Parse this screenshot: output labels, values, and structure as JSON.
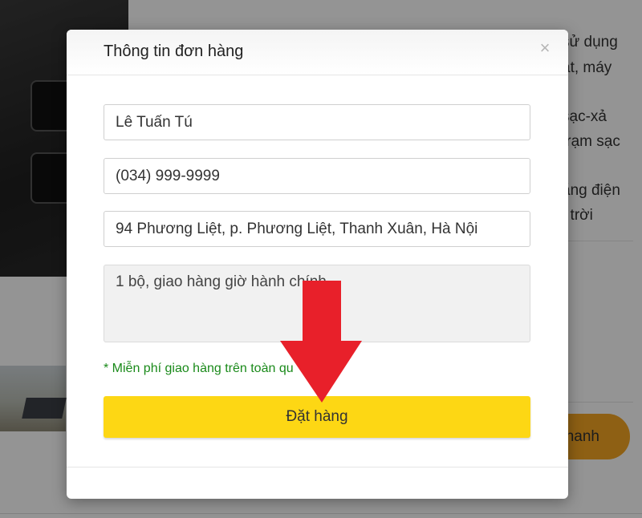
{
  "background": {
    "text_lines": [
      "sử dụng",
      "ạt, máy",
      "sạc-xả",
      "trạm sạc",
      "ăng điện",
      "t trời"
    ],
    "button_label": "nhanh"
  },
  "modal": {
    "title": "Thông tin đơn hàng",
    "close_icon": "close-icon",
    "fields": {
      "name": "Lê Tuấn Tú",
      "phone": "(034) 999-9999",
      "address": "94 Phương Liệt, p. Phương Liệt, Thanh Xuân, Hà Nội",
      "note": "1 bộ, giao hàng giờ hành chính"
    },
    "shipping_note": "* Miễn phí giao hàng trên toàn qu",
    "submit_label": "Đặt hàng"
  },
  "annotation": {
    "icon": "arrow-down-icon",
    "color": "#e8202a"
  },
  "colors": {
    "accent": "#fdd714",
    "note_green": "#1a8a1a",
    "bg_button": "#f5a623"
  }
}
